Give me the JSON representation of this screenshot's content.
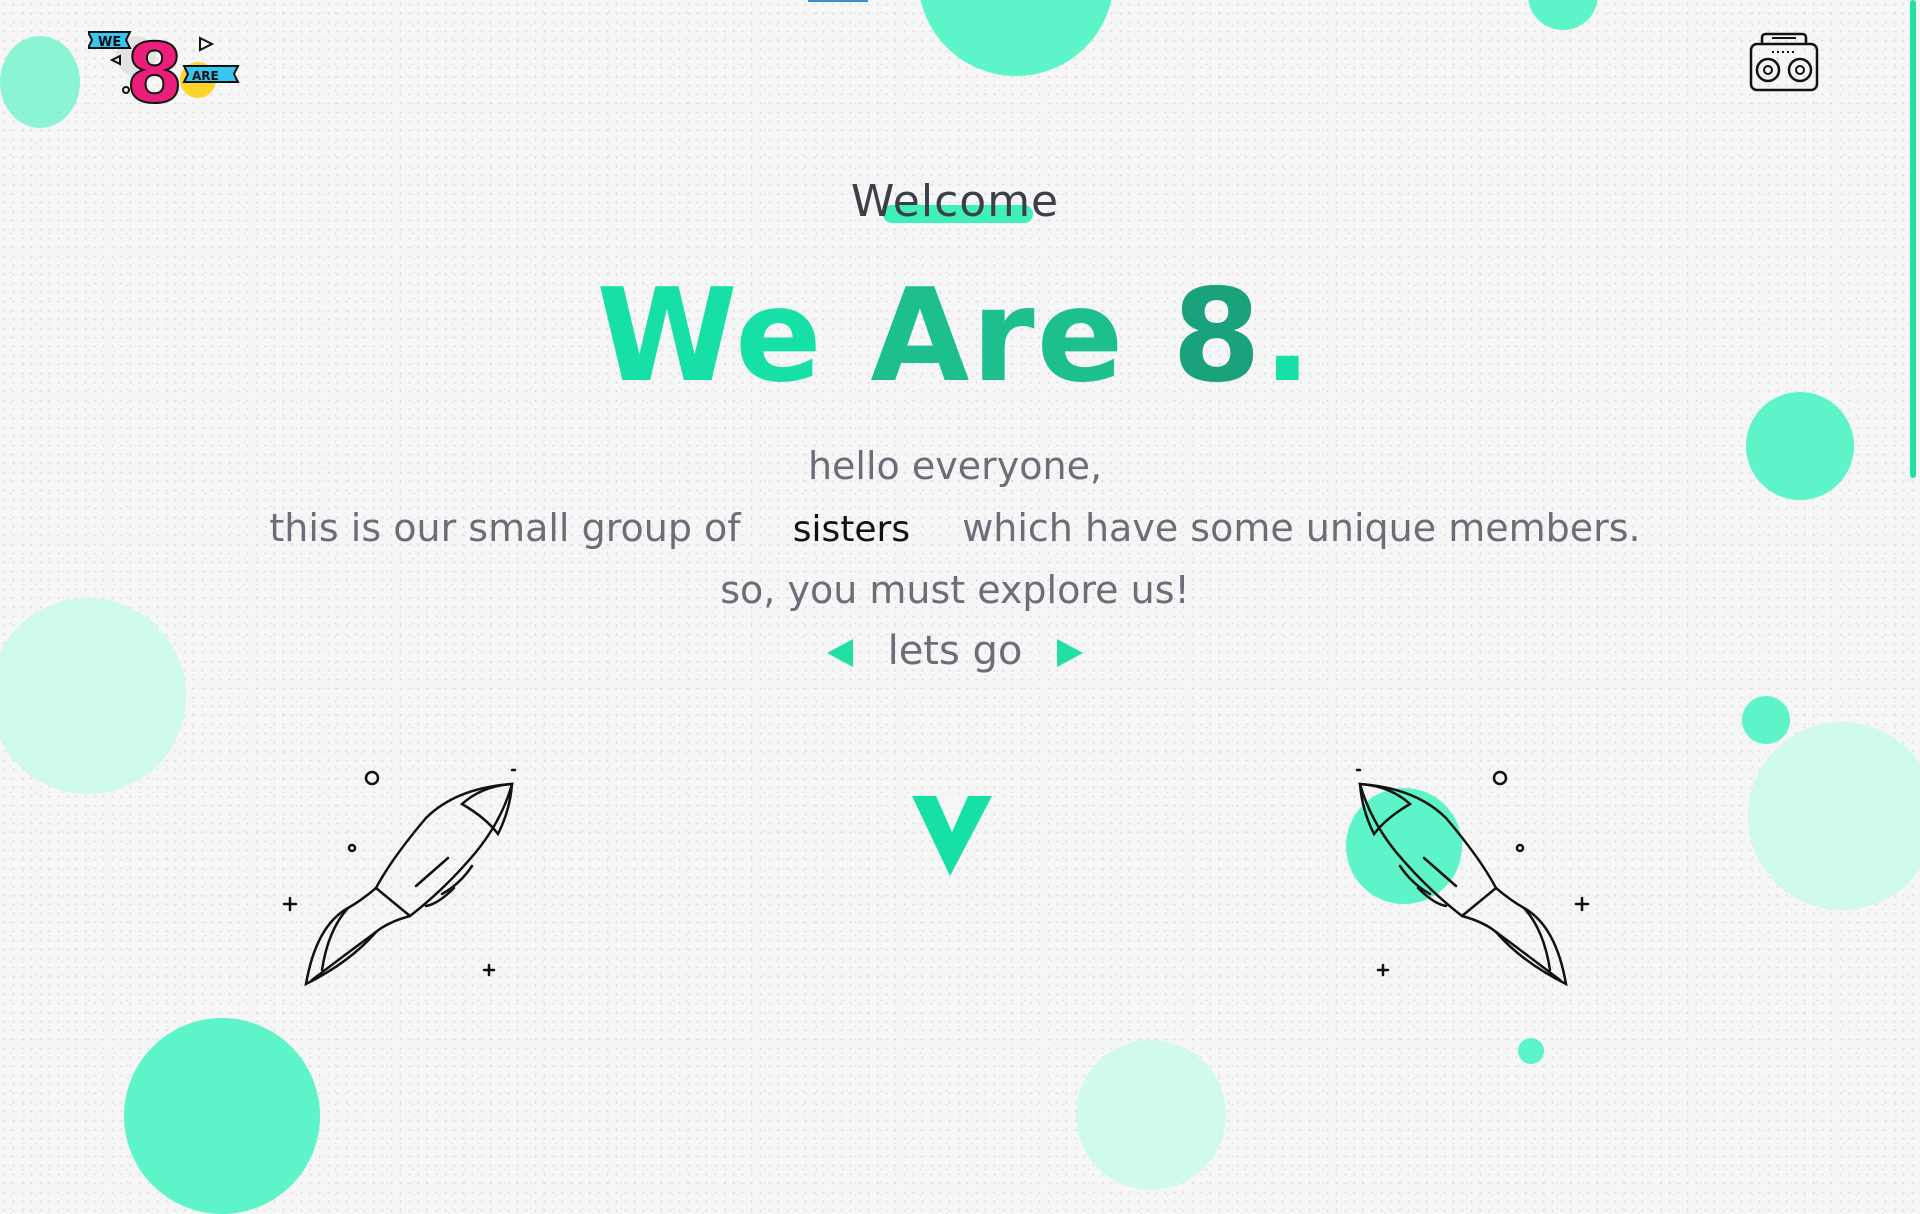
{
  "header": {
    "logo": {
      "text_we": "WE",
      "text_8": "8",
      "text_are": "ARE"
    },
    "radio_icon": "boombox-icon"
  },
  "hero": {
    "welcome": "Welcome",
    "headline": {
      "part1": "We",
      "part2": "Are",
      "part3": "8",
      "dot": "."
    },
    "line1": "hello everyone,",
    "line2_before": "this is our small group of",
    "highlight": "sisters",
    "line2_after": "which have some unique members.",
    "line3": "so, you must explore us!",
    "cta": "lets go"
  },
  "icons": {
    "prev": "triangle-left-icon",
    "next": "triangle-right-icon",
    "down": "chevron-down-icon",
    "rocket": "rocket-icon"
  },
  "colors": {
    "accent": "#16e0a6",
    "accent_dark": "#1aa27c",
    "bubble": "#5cf4c8",
    "text": "#6b6e78",
    "heading": "#3c3f4a",
    "logo_pink": "#ec1e79",
    "logo_blue": "#37c6f0",
    "logo_yellow": "#ffd42a"
  }
}
